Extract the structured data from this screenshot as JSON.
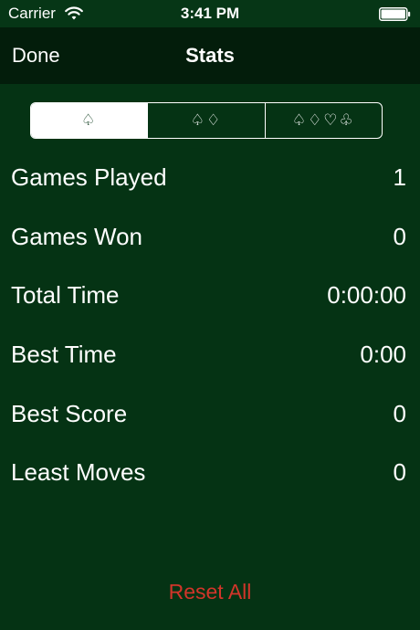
{
  "status_bar": {
    "carrier": "Carrier",
    "time": "3:41 PM",
    "wifi_icon": "wifi-icon",
    "battery_icon": "battery-icon"
  },
  "nav": {
    "done_label": "Done",
    "title": "Stats"
  },
  "suit_selector": {
    "segments": [
      {
        "label": "♤",
        "selected": true
      },
      {
        "label": "♤♢",
        "selected": false
      },
      {
        "label": "♤♢♡♧",
        "selected": false
      }
    ]
  },
  "stats": [
    {
      "label": "Games Played",
      "value": "1"
    },
    {
      "label": "Games Won",
      "value": "0"
    },
    {
      "label": "Total Time",
      "value": "0:00:00"
    },
    {
      "label": "Best Time",
      "value": "0:00"
    },
    {
      "label": "Best Score",
      "value": "0"
    },
    {
      "label": "Least Moves",
      "value": "0"
    }
  ],
  "reset_label": "Reset All",
  "colors": {
    "background": "#053314",
    "nav_background": "#031d0b",
    "reset_text": "#d2352a"
  }
}
